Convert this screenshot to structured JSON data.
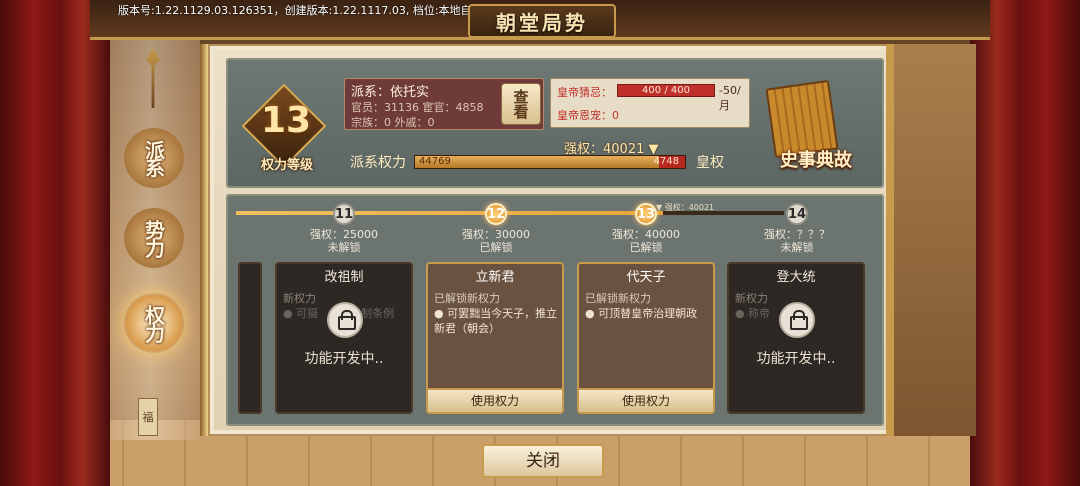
{
  "version_text": "版本号:1.22.1129.03.126351，创建版本:1.22.1117.03, 档位:本地自动档",
  "title": "朝堂局势",
  "side_nav": {
    "tabs": [
      {
        "label": "派系"
      },
      {
        "label": "势力"
      },
      {
        "label": "权力"
      }
    ],
    "charm_label": "福"
  },
  "rank": {
    "level": "13",
    "label": "权力等级"
  },
  "faction": {
    "title": "派系：依托实",
    "row1": "官员：31136 宦官：4858",
    "row2": "宗族：0      外戚：0",
    "view_button": "查看"
  },
  "emperor": {
    "suspicion_label": "皇帝猜忌：",
    "suspicion_value": "400 / 400",
    "suspicion_fraction": 1.0,
    "suspicion_rate": "-50/月",
    "favor": "皇帝恩宠：0"
  },
  "history_label": "史事典故",
  "power": {
    "faction_label": "派系权力",
    "crown_label": "皇权",
    "qiangquan": "强权：40021",
    "faction_value": "44769",
    "crown_value": "4748",
    "fill_fraction": 0.904
  },
  "track": {
    "fill_fraction": 0.78,
    "current_marker": "强权：40021",
    "nodes": [
      {
        "level": "11",
        "req": "强权：25000",
        "status": "未解锁",
        "unlocked": false
      },
      {
        "level": "12",
        "req": "强权：30000",
        "status": "已解锁",
        "unlocked": true
      },
      {
        "level": "13",
        "req": "强权：40000",
        "status": "已解锁",
        "unlocked": true
      },
      {
        "level": "14",
        "req": "强权：？？？",
        "status": "未解锁",
        "unlocked": false
      }
    ]
  },
  "cards": [
    {
      "title": "改祖制",
      "sub": "新权力",
      "desc": "● 可摄",
      "desc2": "祖制条例",
      "dev": "功能开发中..",
      "open": false
    },
    {
      "title": "立新君",
      "sub": "已解锁新权力",
      "desc": "● 可罢黜当今天子，推立新君（朝会）",
      "button": "使用权力",
      "open": true
    },
    {
      "title": "代天子",
      "sub": "已解锁新权力",
      "desc": "● 可顶替皇帝治理朝政",
      "button": "使用权力",
      "open": true
    },
    {
      "title": "登大统",
      "sub": "新权力",
      "desc": "● 称帝",
      "dev": "功能开发中..",
      "open": false
    }
  ],
  "close_button": "关闭",
  "colors": {
    "accent_gold": "#c79b4b",
    "panel_gray": "#6c7470",
    "alert_red": "#c0302a"
  }
}
